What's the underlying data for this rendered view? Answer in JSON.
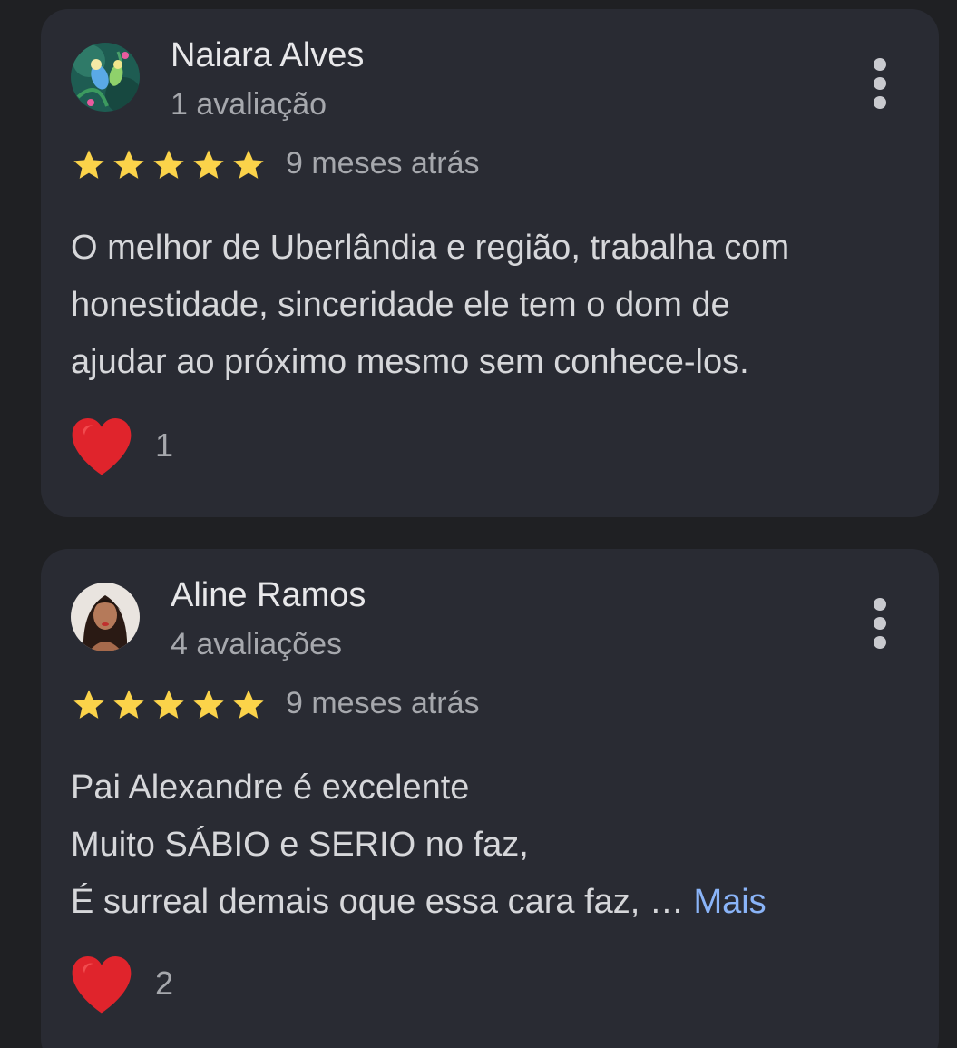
{
  "reviews": [
    {
      "author": "Naiara Alves",
      "review_count": "1 avaliação",
      "rating": 5,
      "date": "9 meses atrás",
      "text_lines": [
        "O melhor de Uberlândia e região, trabalha com",
        "honestidade, sinceridade ele tem o dom de",
        "ajudar ao próximo mesmo sem conhece-los."
      ],
      "reaction_icon": "heart-icon",
      "reaction_count": "1"
    },
    {
      "author": "Aline Ramos",
      "review_count": "4 avaliações",
      "rating": 5,
      "date": "9 meses atrás",
      "text_lines": [
        "Pai Alexandre é excelente",
        "Muito SÁBIO e SERIO no faz,",
        "É surreal demais oque essa cara faz, …"
      ],
      "more_label": "Mais",
      "reaction_icon": "heart-icon",
      "reaction_count": "2"
    }
  ],
  "colors": {
    "background": "#1f2023",
    "card": "#292b33",
    "star": "#fbd34a",
    "heart": "#e0242c",
    "link": "#8ab4f8"
  }
}
